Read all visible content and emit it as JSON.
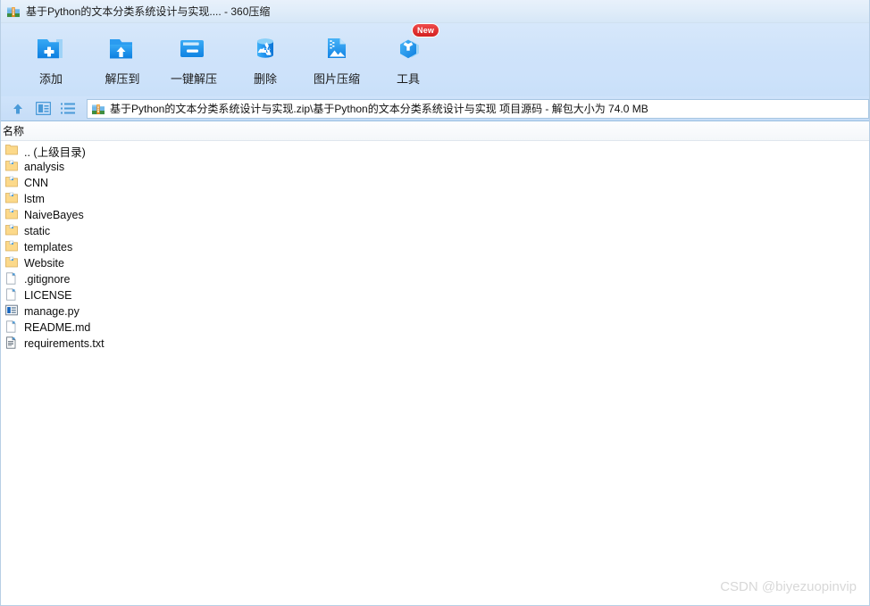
{
  "window": {
    "title": "基于Python的文本分类系统设计与实现.... - 360压缩",
    "title_icon": "zip-archive-icon"
  },
  "toolbar": {
    "buttons": [
      {
        "label": "添加",
        "icon": "folder-add-icon",
        "badge": ""
      },
      {
        "label": "解压到",
        "icon": "folder-extract-up-icon",
        "badge": ""
      },
      {
        "label": "一键解压",
        "icon": "one-click-extract-icon",
        "badge": ""
      },
      {
        "label": "删除",
        "icon": "recycle-bin-icon",
        "badge": ""
      },
      {
        "label": "图片压缩",
        "icon": "image-compress-icon",
        "badge": ""
      },
      {
        "label": "工具",
        "icon": "tools-cube-icon",
        "badge": "New"
      }
    ]
  },
  "navbar": {
    "up_icon": "up-arrow-icon",
    "preview_icon": "preview-pane-icon",
    "list_icon": "list-view-icon",
    "path_icon": "zip-archive-icon",
    "path_text": "基于Python的文本分类系统设计与实现.zip\\基于Python的文本分类系统设计与实现 项目源码 - 解包大小为 74.0 MB"
  },
  "list": {
    "columns": [
      "名称"
    ],
    "rows": [
      {
        "name": ".. (上级目录)",
        "icon": "folder-parent-icon"
      },
      {
        "name": "analysis",
        "icon": "folder-icon"
      },
      {
        "name": "CNN",
        "icon": "folder-icon"
      },
      {
        "name": "lstm",
        "icon": "folder-icon"
      },
      {
        "name": "NaiveBayes",
        "icon": "folder-icon"
      },
      {
        "name": "static",
        "icon": "folder-icon"
      },
      {
        "name": "templates",
        "icon": "folder-icon"
      },
      {
        "name": "Website",
        "icon": "folder-icon"
      },
      {
        "name": ".gitignore",
        "icon": "file-icon"
      },
      {
        "name": "LICENSE",
        "icon": "file-icon"
      },
      {
        "name": "manage.py",
        "icon": "python-file-icon"
      },
      {
        "name": "README.md",
        "icon": "file-icon"
      },
      {
        "name": "requirements.txt",
        "icon": "text-file-icon"
      }
    ]
  },
  "watermark": {
    "text": "CSDN @biyezuopinvip"
  },
  "colors": {
    "accent_blue": "#2196f3",
    "toolbar_bg": "#cfe3fa",
    "folder_yellow": "#f7d488",
    "badge_red": "#d32020"
  }
}
